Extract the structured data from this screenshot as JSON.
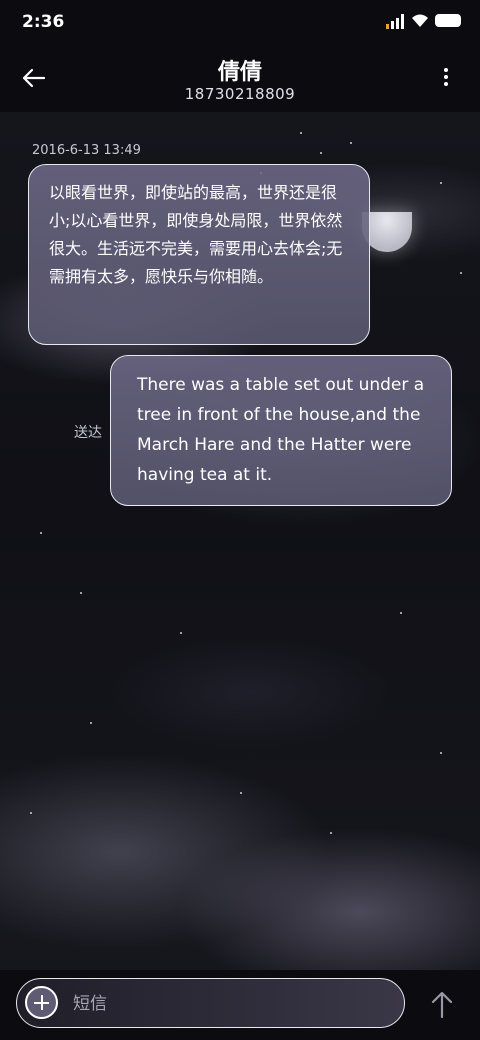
{
  "status_bar": {
    "time": "2:36"
  },
  "header": {
    "contact_name": "倩倩",
    "phone_number": "18730218809"
  },
  "conversation": {
    "timestamp": "2016-6-13 13:49",
    "messages": [
      {
        "direction": "incoming",
        "text": "以眼看世界，即使站的最高，世界还是很小;以心看世界，即使身处局限，世界依然很大。生活远不完美，需要用心去体会;无需拥有太多，愿快乐与你相随。"
      },
      {
        "direction": "outgoing",
        "text": "There was a table set out under a tree in front of the house,and the March Hare and the Hatter were having tea at it.",
        "status": "送达"
      }
    ]
  },
  "composer": {
    "placeholder": "短信"
  },
  "icons": {
    "back": "arrow-left-icon",
    "more": "more-vertical-icon",
    "add": "plus-icon",
    "send": "arrow-up-icon"
  },
  "colors": {
    "bubble": "#6e6987",
    "background": "#0b0b10",
    "border": "#e8e8ee"
  }
}
